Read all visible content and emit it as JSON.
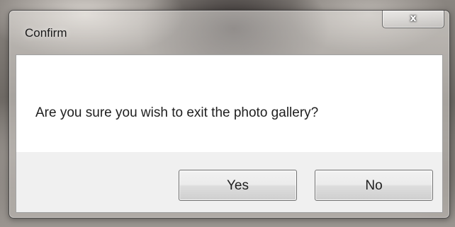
{
  "dialog": {
    "title": "Confirm",
    "close_glyph": "x",
    "message": "Are you sure you wish to exit the photo gallery?",
    "buttons": {
      "yes_label": "Yes",
      "no_label": "No"
    }
  },
  "icons": {
    "close": "close-icon"
  },
  "colors": {
    "client_background": "#ffffff",
    "button_area_background": "#f0f0f0",
    "button_border": "#707070",
    "text": "#1e1e1e"
  }
}
